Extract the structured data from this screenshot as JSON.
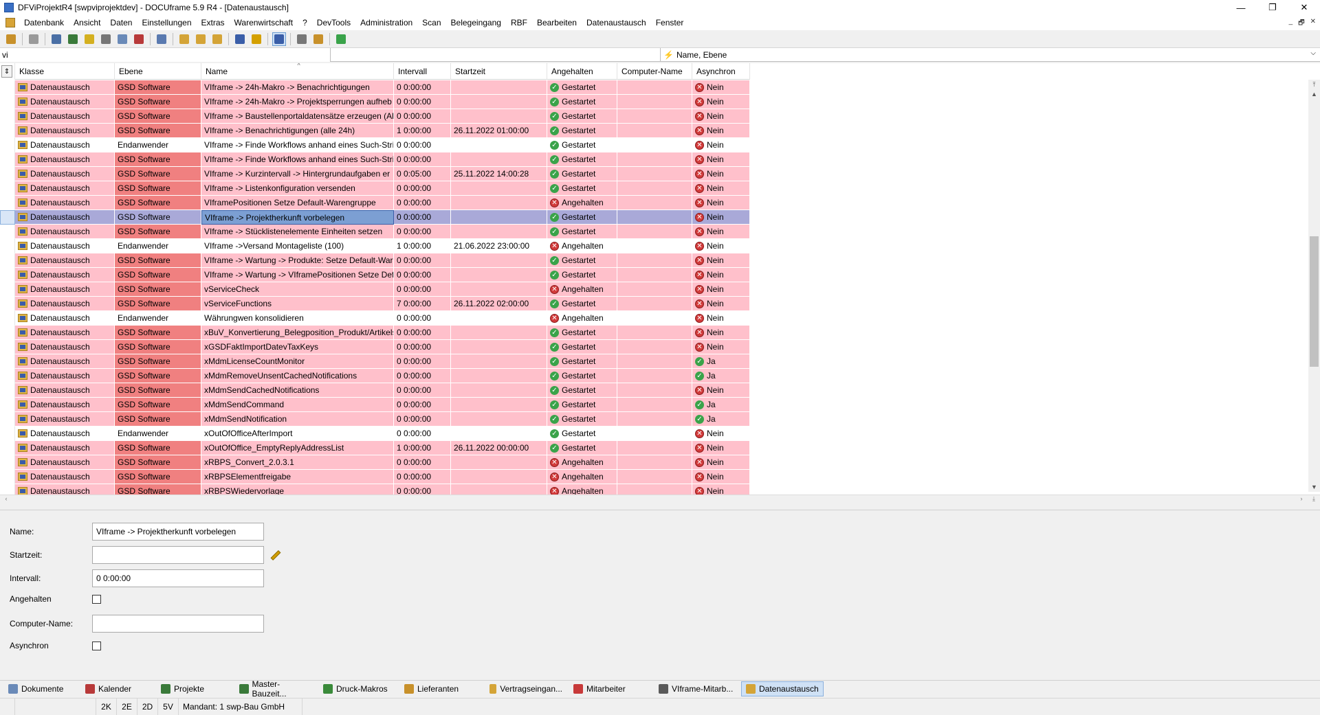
{
  "window": {
    "title": "DFViProjektR4 [swpviprojektdev] - DOCUframe 5.9 R4 - [Datenaustausch]",
    "controls": [
      "—",
      "❐",
      "✕"
    ]
  },
  "menu": {
    "items": [
      "Datenbank",
      "Ansicht",
      "Daten",
      "Einstellungen",
      "Extras",
      "Warenwirtschaft",
      "?",
      "DevTools",
      "Administration",
      "Scan",
      "Belegeingang",
      "RBF",
      "Bearbeiten",
      "Datenaustausch",
      "Fenster"
    ],
    "mdi_controls": [
      "_",
      "🗗",
      "✕"
    ]
  },
  "toolbar": {
    "buttons": [
      {
        "icon": "open-db-icon",
        "color": "#c8912b"
      },
      {
        "icon": "print-icon",
        "color": "#9a9a9a"
      },
      {
        "icon": "card-icon",
        "color": "#4a6fa5"
      },
      {
        "icon": "list-icon",
        "color": "#3a7a3a"
      },
      {
        "icon": "note-icon",
        "color": "#d4b020"
      },
      {
        "icon": "attach-icon",
        "color": "#777777"
      },
      {
        "icon": "copy-icon",
        "color": "#6a8ab8"
      },
      {
        "icon": "calendar-icon",
        "color": "#b83a3a"
      },
      {
        "icon": "phone-icon",
        "color": "#5a7ab0"
      },
      {
        "icon": "folder-icon",
        "color": "#d4a437"
      },
      {
        "icon": "folder-open-icon",
        "color": "#d4a437"
      },
      {
        "icon": "folder-arrow-icon",
        "color": "#d4a437"
      },
      {
        "icon": "search-icon",
        "color": "#3a5ea8"
      },
      {
        "icon": "search-star-icon",
        "color": "#d4a000"
      },
      {
        "icon": "layout-icon",
        "color": "#3a5ea8"
      },
      {
        "icon": "tools-icon",
        "color": "#777777"
      },
      {
        "icon": "users-icon",
        "color": "#c8912b"
      },
      {
        "icon": "check-pencil-icon",
        "color": "#3aa34a"
      }
    ]
  },
  "filter": {
    "value": "vi",
    "sort_label": "Name, Ebene"
  },
  "grid": {
    "columns": [
      "Klasse",
      "Ebene",
      "Name",
      "Intervall",
      "Startzeit",
      "Angehalten",
      "Computer-Name",
      "Asynchron"
    ],
    "rows": [
      {
        "klasse": "Datenaustausch",
        "ebene": "GSD Software",
        "name": "VIframe -> 24h-Makro -> Benachrichtigungen",
        "intervall": "0 0:00:00",
        "startzeit": "",
        "angehalten": "Gestartet",
        "computer": "",
        "async": "Nein",
        "style": "pink"
      },
      {
        "klasse": "Datenaustausch",
        "ebene": "GSD Software",
        "name": "VIframe -> 24h-Makro -> Projektsperrungen aufheb",
        "intervall": "0 0:00:00",
        "startzeit": "",
        "angehalten": "Gestartet",
        "computer": "",
        "async": "Nein",
        "style": "pink"
      },
      {
        "klasse": "Datenaustausch",
        "ebene": "GSD Software",
        "name": "VIframe -> Baustellenportaldatensätze erzeugen (All",
        "intervall": "0 0:00:00",
        "startzeit": "",
        "angehalten": "Gestartet",
        "computer": "",
        "async": "Nein",
        "style": "pink"
      },
      {
        "klasse": "Datenaustausch",
        "ebene": "GSD Software",
        "name": "VIframe -> Benachrichtigungen (alle 24h)",
        "intervall": "1 0:00:00",
        "startzeit": "26.11.2022 01:00:00",
        "angehalten": "Gestartet",
        "computer": "",
        "async": "Nein",
        "style": "pink"
      },
      {
        "klasse": "Datenaustausch",
        "ebene": "Endanwender",
        "name": "VIframe -> Finde Workflows anhand eines Such-Stri",
        "intervall": "0 0:00:00",
        "startzeit": "",
        "angehalten": "Gestartet",
        "computer": "",
        "async": "Nein",
        "style": "white"
      },
      {
        "klasse": "Datenaustausch",
        "ebene": "GSD Software",
        "name": "VIframe -> Finde Workflows anhand eines Such-Stri",
        "intervall": "0 0:00:00",
        "startzeit": "",
        "angehalten": "Gestartet",
        "computer": "",
        "async": "Nein",
        "style": "pink"
      },
      {
        "klasse": "Datenaustausch",
        "ebene": "GSD Software",
        "name": "VIframe -> Kurzintervall -> Hintergrundaufgaben er",
        "intervall": "0 0:05:00",
        "startzeit": "25.11.2022 14:00:28",
        "angehalten": "Gestartet",
        "computer": "",
        "async": "Nein",
        "style": "pink"
      },
      {
        "klasse": "Datenaustausch",
        "ebene": "GSD Software",
        "name": "VIframe -> Listenkonfiguration versenden",
        "intervall": "0 0:00:00",
        "startzeit": "",
        "angehalten": "Gestartet",
        "computer": "",
        "async": "Nein",
        "style": "pink"
      },
      {
        "klasse": "Datenaustausch",
        "ebene": "GSD Software",
        "name": "VIframePositionen Setze Default-Warengruppe",
        "intervall": "0 0:00:00",
        "startzeit": "",
        "angehalten": "Angehalten",
        "computer": "",
        "async": "Nein",
        "style": "pink"
      },
      {
        "klasse": "Datenaustausch",
        "ebene": "GSD Software",
        "name": "VIframe -> Projektherkunft vorbelegen",
        "intervall": "0 0:00:00",
        "startzeit": "",
        "angehalten": "Gestartet",
        "computer": "",
        "async": "Nein",
        "style": "sel"
      },
      {
        "klasse": "Datenaustausch",
        "ebene": "GSD Software",
        "name": "VIframe -> Stücklistenelemente Einheiten setzen",
        "intervall": "0 0:00:00",
        "startzeit": "",
        "angehalten": "Gestartet",
        "computer": "",
        "async": "Nein",
        "style": "pink"
      },
      {
        "klasse": "Datenaustausch",
        "ebene": "Endanwender",
        "name": "VIframe ->Versand Montageliste (100)",
        "intervall": "1 0:00:00",
        "startzeit": "21.06.2022 23:00:00",
        "angehalten": "Angehalten",
        "computer": "",
        "async": "Nein",
        "style": "white"
      },
      {
        "klasse": "Datenaustausch",
        "ebene": "GSD Software",
        "name": "VIframe -> Wartung -> Produkte: Setze Default-War",
        "intervall": "0 0:00:00",
        "startzeit": "",
        "angehalten": "Gestartet",
        "computer": "",
        "async": "Nein",
        "style": "pink"
      },
      {
        "klasse": "Datenaustausch",
        "ebene": "GSD Software",
        "name": "VIframe -> Wartung -> VIframePositionen Setze Def",
        "intervall": "0 0:00:00",
        "startzeit": "",
        "angehalten": "Gestartet",
        "computer": "",
        "async": "Nein",
        "style": "pink"
      },
      {
        "klasse": "Datenaustausch",
        "ebene": "GSD Software",
        "name": "vServiceCheck",
        "intervall": "0 0:00:00",
        "startzeit": "",
        "angehalten": "Angehalten",
        "computer": "",
        "async": "Nein",
        "style": "pink"
      },
      {
        "klasse": "Datenaustausch",
        "ebene": "GSD Software",
        "name": "vServiceFunctions",
        "intervall": "7 0:00:00",
        "startzeit": "26.11.2022 02:00:00",
        "angehalten": "Gestartet",
        "computer": "",
        "async": "Nein",
        "style": "pink"
      },
      {
        "klasse": "Datenaustausch",
        "ebene": "Endanwender",
        "name": "Währungwen konsolidieren",
        "intervall": "0 0:00:00",
        "startzeit": "",
        "angehalten": "Angehalten",
        "computer": "",
        "async": "Nein",
        "style": "white"
      },
      {
        "klasse": "Datenaustausch",
        "ebene": "GSD Software",
        "name": "xBuV_Konvertierung_Belegposition_Produkt/Artikels",
        "intervall": "0 0:00:00",
        "startzeit": "",
        "angehalten": "Gestartet",
        "computer": "",
        "async": "Nein",
        "style": "pink"
      },
      {
        "klasse": "Datenaustausch",
        "ebene": "GSD Software",
        "name": "xGSDFaktImportDatevTaxKeys",
        "intervall": "0 0:00:00",
        "startzeit": "",
        "angehalten": "Gestartet",
        "computer": "",
        "async": "Nein",
        "style": "pink"
      },
      {
        "klasse": "Datenaustausch",
        "ebene": "GSD Software",
        "name": "xMdmLicenseCountMonitor",
        "intervall": "0 0:00:00",
        "startzeit": "",
        "angehalten": "Gestartet",
        "computer": "",
        "async": "Ja",
        "style": "pink"
      },
      {
        "klasse": "Datenaustausch",
        "ebene": "GSD Software",
        "name": "xMdmRemoveUnsentCachedNotifications",
        "intervall": "0 0:00:00",
        "startzeit": "",
        "angehalten": "Gestartet",
        "computer": "",
        "async": "Ja",
        "style": "pink"
      },
      {
        "klasse": "Datenaustausch",
        "ebene": "GSD Software",
        "name": "xMdmSendCachedNotifications",
        "intervall": "0 0:00:00",
        "startzeit": "",
        "angehalten": "Gestartet",
        "computer": "",
        "async": "Nein",
        "style": "pink"
      },
      {
        "klasse": "Datenaustausch",
        "ebene": "GSD Software",
        "name": "xMdmSendCommand",
        "intervall": "0 0:00:00",
        "startzeit": "",
        "angehalten": "Gestartet",
        "computer": "",
        "async": "Ja",
        "style": "pink"
      },
      {
        "klasse": "Datenaustausch",
        "ebene": "GSD Software",
        "name": "xMdmSendNotification",
        "intervall": "0 0:00:00",
        "startzeit": "",
        "angehalten": "Gestartet",
        "computer": "",
        "async": "Ja",
        "style": "pink"
      },
      {
        "klasse": "Datenaustausch",
        "ebene": "Endanwender",
        "name": "xOutOfOfficeAfterImport",
        "intervall": "0 0:00:00",
        "startzeit": "",
        "angehalten": "Gestartet",
        "computer": "",
        "async": "Nein",
        "style": "white"
      },
      {
        "klasse": "Datenaustausch",
        "ebene": "GSD Software",
        "name": "xOutOfOffice_EmptyReplyAddressList",
        "intervall": "1 0:00:00",
        "startzeit": "26.11.2022 00:00:00",
        "angehalten": "Gestartet",
        "computer": "",
        "async": "Nein",
        "style": "pink"
      },
      {
        "klasse": "Datenaustausch",
        "ebene": "GSD Software",
        "name": "xRBPS_Convert_2.0.3.1",
        "intervall": "0 0:00:00",
        "startzeit": "",
        "angehalten": "Angehalten",
        "computer": "",
        "async": "Nein",
        "style": "pink"
      },
      {
        "klasse": "Datenaustausch",
        "ebene": "GSD Software",
        "name": "xRBPSElementfreigabe",
        "intervall": "0 0:00:00",
        "startzeit": "",
        "angehalten": "Angehalten",
        "computer": "",
        "async": "Nein",
        "style": "pink"
      },
      {
        "klasse": "Datenaustausch",
        "ebene": "GSD Software",
        "name": "xRBPSWiedervorlage",
        "intervall": "0 0:00:00",
        "startzeit": "",
        "angehalten": "Angehalten",
        "computer": "",
        "async": "Nein",
        "style": "pink"
      }
    ]
  },
  "detail": {
    "name_label": "Name:",
    "name_value": "VIframe -> Projektherkunft vorbelegen",
    "startzeit_label": "Startzeit:",
    "startzeit_value": "",
    "intervall_label": "Intervall:",
    "intervall_value": "0 0:00:00",
    "angehalten_label": "Angehalten",
    "computer_label": "Computer-Name:",
    "computer_value": "",
    "asynchron_label": "Asynchron"
  },
  "tabs": [
    {
      "label": "Dokumente",
      "icon": "documents-icon",
      "color": "#6a8ab8"
    },
    {
      "label": "Kalender",
      "icon": "calendar-icon",
      "color": "#b83a3a"
    },
    {
      "label": "Projekte",
      "icon": "projects-icon",
      "color": "#3a7a3a"
    },
    {
      "label": "Master-Bauzeit...",
      "icon": "master-icon",
      "color": "#3a7a3a"
    },
    {
      "label": "Druck-Makros",
      "icon": "print-macro-icon",
      "color": "#3a8a3a"
    },
    {
      "label": "Lieferanten",
      "icon": "supplier-icon",
      "color": "#c8912b"
    },
    {
      "label": "Vertragseingan...",
      "icon": "contract-icon",
      "color": "#d4a437"
    },
    {
      "label": "Mitarbeiter",
      "icon": "employee-icon",
      "color": "#c83a3a"
    },
    {
      "label": "VIframe-Mitarb...",
      "icon": "viframe-icon",
      "color": "#5a5a5a"
    },
    {
      "label": "Datenaustausch",
      "icon": "exchange-icon",
      "color": "#d4a437",
      "active": true
    }
  ],
  "status": {
    "cells": [
      "",
      "",
      "2K",
      "2E",
      "2D",
      "5V"
    ],
    "mandant": "Mandant: 1 swp-Bau GmbH"
  }
}
